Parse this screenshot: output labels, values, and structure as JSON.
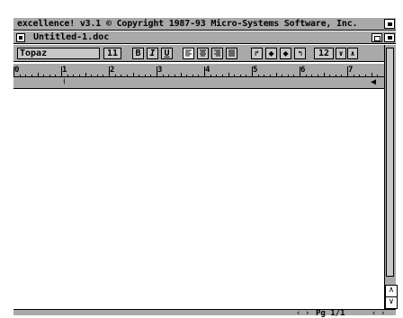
{
  "screen": {
    "title": "excellence! v3.1 © Copyright 1987-93 Micro-Systems Software, Inc."
  },
  "window": {
    "title": "Untitled-1.doc"
  },
  "toolbar": {
    "font_name": "Topaz",
    "font_size": "11",
    "style_buttons": [
      {
        "name": "bold",
        "label": "B"
      },
      {
        "name": "italic",
        "label": "I"
      },
      {
        "name": "underline",
        "label": "U"
      }
    ],
    "align_buttons": [
      {
        "name": "align-left",
        "icon": "align-left-icon"
      },
      {
        "name": "align-center",
        "icon": "align-center-icon"
      },
      {
        "name": "align-right",
        "icon": "align-right-icon"
      },
      {
        "name": "align-justify",
        "icon": "align-justify-icon"
      }
    ],
    "tab_buttons": [
      {
        "name": "tab-left",
        "icon": "tab-left-icon"
      },
      {
        "name": "tab-center",
        "icon": "tab-center-icon"
      },
      {
        "name": "tab-decimal",
        "icon": "tab-decimal-icon"
      },
      {
        "name": "tab-right",
        "icon": "tab-right-icon"
      }
    ],
    "line_spacing": "12"
  },
  "ruler": {
    "numbers": [
      "0",
      "1",
      "2",
      "3",
      "4",
      "5",
      "6",
      "7"
    ]
  },
  "status": {
    "page_indicator": "Pg 1/1"
  },
  "colors": {
    "chrome_gray": "#a9a9a9",
    "paper": "#ffffff",
    "ink": "#000000"
  }
}
